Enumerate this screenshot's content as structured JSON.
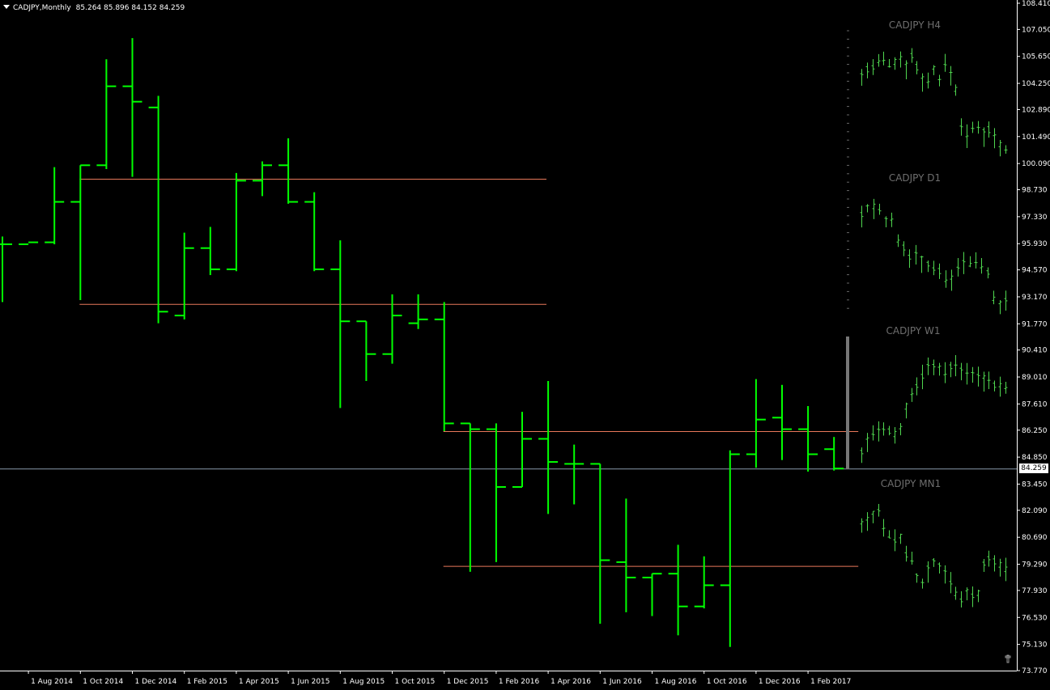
{
  "header": {
    "symbol": "CADJPY,Monthly",
    "ohlc": "85.264 85.896 84.152 84.259"
  },
  "current_price_label": "84.259",
  "colors": {
    "background": "#000000",
    "bars": "#00ff00",
    "mini_bars": "#4fd64f",
    "level_lines": "#e8785a",
    "price_line": "#8899aa",
    "mini_label": "#6e6e6e"
  },
  "mini_labels": [
    "CADJPY H4",
    "CADJPY D1",
    "CADJPY W1",
    "CADJPY MN1"
  ],
  "chart_data": {
    "type": "ohlc",
    "title": "CADJPY,Monthly",
    "y_ticks": [
      "108.410",
      "107.050",
      "105.650",
      "104.250",
      "102.890",
      "101.490",
      "100.090",
      "98.730",
      "97.330",
      "95.930",
      "94.570",
      "93.170",
      "91.770",
      "90.410",
      "89.010",
      "87.610",
      "86.250",
      "84.850",
      "83.450",
      "82.090",
      "80.690",
      "79.290",
      "77.930",
      "76.530",
      "75.130",
      "73.770"
    ],
    "x_ticks": [
      "1 Aug 2014",
      "1 Oct 2014",
      "1 Dec 2014",
      "1 Feb 2015",
      "1 Apr 2015",
      "1 Jun 2015",
      "1 Aug 2015",
      "1 Oct 2015",
      "1 Dec 2015",
      "1 Feb 2016",
      "1 Apr 2016",
      "1 Jun 2016",
      "1 Aug 2016",
      "1 Oct 2016",
      "1 Dec 2016",
      "1 Feb 2017"
    ],
    "ylim": [
      73.77,
      108.41
    ],
    "bars": [
      {
        "date": "2014-07",
        "open": 95.9,
        "high": 96.3,
        "low": 92.9,
        "close": 95.9
      },
      {
        "date": "2014-08",
        "open": 95.9,
        "high": 95.9,
        "low": 95.9,
        "close": 96.0
      },
      {
        "date": "2014-09",
        "open": 96.0,
        "high": 99.9,
        "low": 95.9,
        "close": 98.1
      },
      {
        "date": "2014-10",
        "open": 98.1,
        "high": 100.0,
        "low": 93.0,
        "close": 100.0
      },
      {
        "date": "2014-11",
        "open": 100.0,
        "high": 105.5,
        "low": 99.8,
        "close": 104.1
      },
      {
        "date": "2014-12",
        "open": 104.1,
        "high": 106.6,
        "low": 99.4,
        "close": 103.3
      },
      {
        "date": "2015-01",
        "open": 103.0,
        "high": 103.6,
        "low": 91.8,
        "close": 92.4
      },
      {
        "date": "2015-02",
        "open": 92.2,
        "high": 96.5,
        "low": 92.0,
        "close": 95.7
      },
      {
        "date": "2015-03",
        "open": 95.7,
        "high": 96.8,
        "low": 94.3,
        "close": 94.6
      },
      {
        "date": "2015-04",
        "open": 94.6,
        "high": 99.6,
        "low": 94.5,
        "close": 99.2
      },
      {
        "date": "2015-05",
        "open": 99.2,
        "high": 100.2,
        "low": 98.4,
        "close": 100.0
      },
      {
        "date": "2015-06",
        "open": 100.0,
        "high": 101.4,
        "low": 98.0,
        "close": 98.1
      },
      {
        "date": "2015-07",
        "open": 98.1,
        "high": 98.6,
        "low": 94.5,
        "close": 94.6
      },
      {
        "date": "2015-08",
        "open": 94.6,
        "high": 96.1,
        "low": 87.4,
        "close": 91.9
      },
      {
        "date": "2015-09",
        "open": 91.9,
        "high": 91.9,
        "low": 88.8,
        "close": 90.2
      },
      {
        "date": "2015-10",
        "open": 90.2,
        "high": 93.3,
        "low": 89.7,
        "close": 92.2
      },
      {
        "date": "2015-11",
        "open": 91.8,
        "high": 93.3,
        "low": 91.5,
        "close": 92.0
      },
      {
        "date": "2015-12",
        "open": 92.0,
        "high": 92.9,
        "low": 86.2,
        "close": 86.6
      },
      {
        "date": "2016-01",
        "open": 86.6,
        "high": 86.6,
        "low": 78.9,
        "close": 86.3
      },
      {
        "date": "2016-02",
        "open": 86.3,
        "high": 86.6,
        "low": 79.4,
        "close": 83.3
      },
      {
        "date": "2016-03",
        "open": 83.3,
        "high": 87.2,
        "low": 83.3,
        "close": 85.8
      },
      {
        "date": "2016-04",
        "open": 85.8,
        "high": 88.8,
        "low": 81.9,
        "close": 84.6
      },
      {
        "date": "2016-05",
        "open": 84.5,
        "high": 85.5,
        "low": 82.4,
        "close": 84.5
      },
      {
        "date": "2016-06",
        "open": 84.5,
        "high": 84.5,
        "low": 76.2,
        "close": 79.5
      },
      {
        "date": "2016-07",
        "open": 79.4,
        "high": 82.7,
        "low": 76.8,
        "close": 78.6
      },
      {
        "date": "2016-08",
        "open": 78.6,
        "high": 78.8,
        "low": 76.6,
        "close": 78.8
      },
      {
        "date": "2016-09",
        "open": 78.8,
        "high": 80.3,
        "low": 75.6,
        "close": 77.1
      },
      {
        "date": "2016-10",
        "open": 77.1,
        "high": 79.7,
        "low": 77.0,
        "close": 78.2
      },
      {
        "date": "2016-11",
        "open": 78.2,
        "high": 85.2,
        "low": 75.0,
        "close": 85.0
      },
      {
        "date": "2016-12",
        "open": 85.0,
        "high": 88.9,
        "low": 84.3,
        "close": 86.8
      },
      {
        "date": "2017-01",
        "open": 86.9,
        "high": 88.6,
        "low": 84.7,
        "close": 86.3
      },
      {
        "date": "2017-02",
        "open": 86.3,
        "high": 87.5,
        "low": 84.1,
        "close": 85.0
      },
      {
        "date": "2017-03",
        "open": 85.264,
        "high": 85.896,
        "low": 84.152,
        "close": 84.259
      }
    ],
    "current_price": 84.259,
    "levels": [
      {
        "price": 99.3,
        "from": "2014-10",
        "to": "2016-03"
      },
      {
        "price": 92.8,
        "from": "2014-10",
        "to": "2016-03"
      },
      {
        "price": 86.2,
        "from": "2015-12",
        "to": "2017-03"
      },
      {
        "price": 79.2,
        "from": "2015-12",
        "to": "2017-03"
      }
    ]
  }
}
